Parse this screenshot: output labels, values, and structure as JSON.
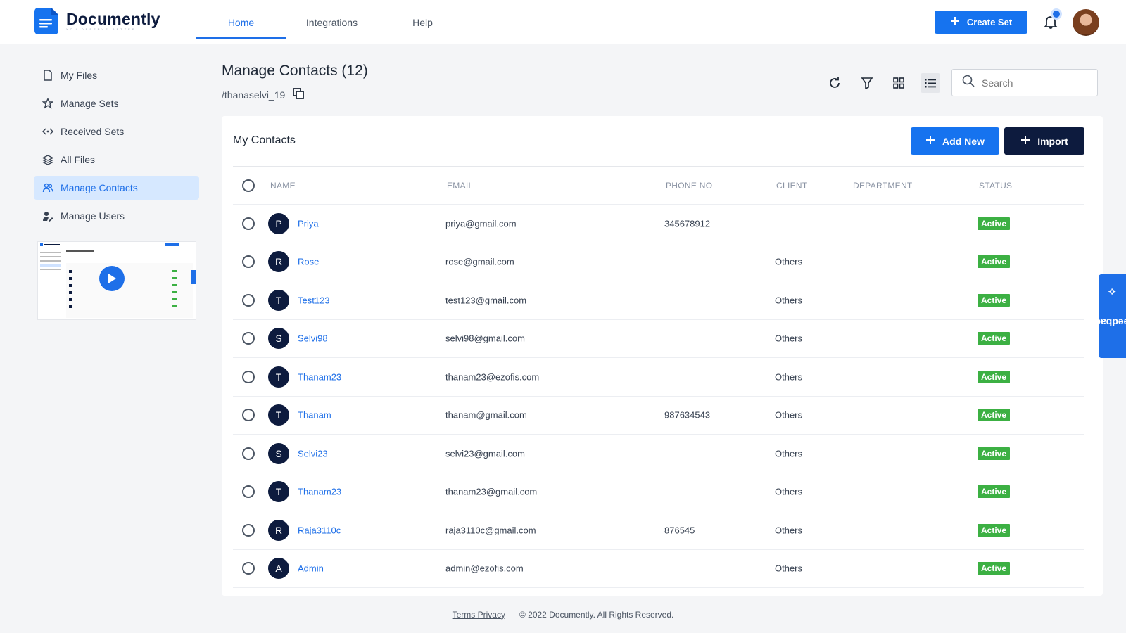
{
  "brand": {
    "name": "Documently",
    "tagline": "YOU DESERVE BETTER"
  },
  "nav": {
    "tabs": [
      {
        "label": "Home",
        "active": true
      },
      {
        "label": "Integrations"
      },
      {
        "label": "Help"
      }
    ]
  },
  "header": {
    "create_label": "Create Set"
  },
  "sidebar": {
    "items": [
      {
        "label": "My Files",
        "icon": "file-icon"
      },
      {
        "label": "Manage Sets",
        "icon": "star-icon"
      },
      {
        "label": "Received Sets",
        "icon": "code-icon"
      },
      {
        "label": "All Files",
        "icon": "layers-icon"
      },
      {
        "label": "Manage Contacts",
        "icon": "users-icon",
        "active": true
      },
      {
        "label": "Manage Users",
        "icon": "user-edit-icon"
      }
    ]
  },
  "page": {
    "title": "Manage Contacts (12)",
    "path": "/thanaselvi_19"
  },
  "search": {
    "placeholder": "Search"
  },
  "card": {
    "title": "My Contacts",
    "add_label": "Add New",
    "import_label": "Import"
  },
  "table": {
    "columns": [
      "NAME",
      "EMAIL",
      "PHONE NO",
      "CLIENT",
      "DEPARTMENT",
      "STATUS"
    ],
    "rows": [
      {
        "initial": "P",
        "name": "Priya",
        "email": "priya@gmail.com",
        "phone": "345678912",
        "client": "",
        "department": "",
        "status": "Active"
      },
      {
        "initial": "R",
        "name": "Rose",
        "email": "rose@gmail.com",
        "phone": "",
        "client": "Others",
        "department": "",
        "status": "Active"
      },
      {
        "initial": "T",
        "name": "Test123",
        "email": "test123@gmail.com",
        "phone": "",
        "client": "Others",
        "department": "",
        "status": "Active"
      },
      {
        "initial": "S",
        "name": "Selvi98",
        "email": "selvi98@gmail.com",
        "phone": "",
        "client": "Others",
        "department": "",
        "status": "Active"
      },
      {
        "initial": "T",
        "name": "Thanam23",
        "email": "thanam23@ezofis.com",
        "phone": "",
        "client": "Others",
        "department": "",
        "status": "Active"
      },
      {
        "initial": "T",
        "name": "Thanam",
        "email": "thanam@gmail.com",
        "phone": "987634543",
        "client": "Others",
        "department": "",
        "status": "Active"
      },
      {
        "initial": "S",
        "name": "Selvi23",
        "email": "selvi23@gmail.com",
        "phone": "",
        "client": "Others",
        "department": "",
        "status": "Active"
      },
      {
        "initial": "T",
        "name": "Thanam23",
        "email": "thanam23@gmail.com",
        "phone": "",
        "client": "Others",
        "department": "",
        "status": "Active"
      },
      {
        "initial": "R",
        "name": "Raja3110c",
        "email": "raja3110c@gmail.com",
        "phone": "876545",
        "client": "Others",
        "department": "",
        "status": "Active"
      },
      {
        "initial": "A",
        "name": "Admin",
        "email": "admin@ezofis.com",
        "phone": "",
        "client": "Others",
        "department": "",
        "status": "Active"
      }
    ]
  },
  "feedback": {
    "label": "Feedback"
  },
  "footer": {
    "links": "Terms Privacy",
    "copyright": "© 2022 Documently. All Rights Reserved."
  },
  "colors": {
    "primary": "#1673ef",
    "navy": "#0d1b3e",
    "active_badge": "#3cb043",
    "sidebar_active_bg": "#d6e8ff"
  }
}
